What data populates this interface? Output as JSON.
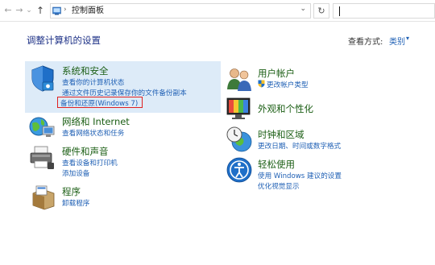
{
  "addressbar": {
    "back": "←",
    "forward": "→",
    "recent": "⌄",
    "up": "↑",
    "separator": "›",
    "location": "控制面板",
    "dropdown": "⌄",
    "refresh": "↻"
  },
  "header": {
    "title": "调整计算机的设置",
    "view_by_label": "查看方式:",
    "view_by_value": "类别",
    "view_by_arrow": "▾"
  },
  "left_categories": [
    {
      "title": "系统和安全",
      "links": [
        "查看你的计算机状态",
        "通过文件历史记录保存你的文件备份副本",
        "备份和还原(Windows 7)"
      ]
    },
    {
      "title": "网络和 Internet",
      "links": [
        "查看网络状态和任务"
      ]
    },
    {
      "title": "硬件和声音",
      "links": [
        "查看设备和打印机",
        "添加设备"
      ]
    },
    {
      "title": "程序",
      "links": [
        "卸载程序"
      ]
    }
  ],
  "right_categories": [
    {
      "title": "用户帐户",
      "links": [
        "更改帐户类型"
      ]
    },
    {
      "title": "外观和个性化",
      "links": []
    },
    {
      "title": "时钟和区域",
      "links": [
        "更改日期、时间或数字格式"
      ]
    },
    {
      "title": "轻松使用",
      "links": [
        "使用 Windows 建议的设置",
        "优化视觉显示"
      ]
    }
  ],
  "icons": [
    "system-security-shield-icon",
    "network-globe-icon",
    "hardware-printer-icon",
    "programs-box-icon",
    "user-accounts-icon",
    "appearance-monitor-icon",
    "clock-globe-icon",
    "ease-of-access-icon",
    "uac-shield-icon"
  ],
  "colors": {
    "category_title": "#1b5e14",
    "link": "#1e5fb4",
    "title": "#1e3287",
    "highlight_bg": "#ddebf8",
    "red_box": "#e02020"
  }
}
